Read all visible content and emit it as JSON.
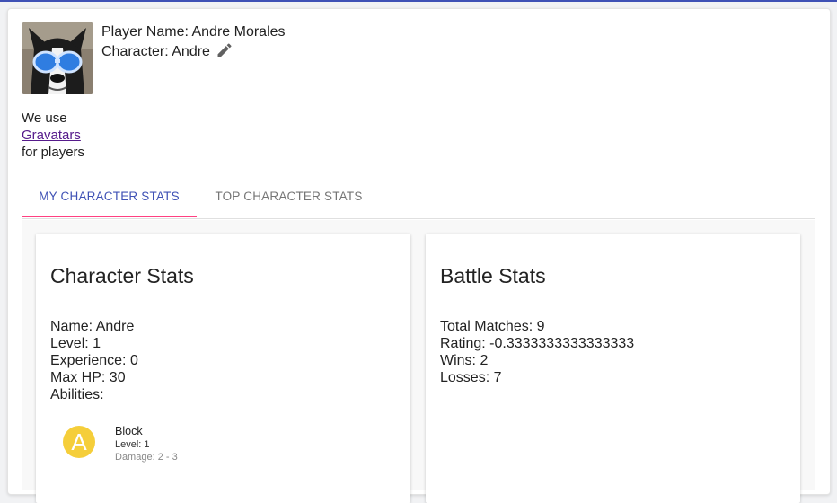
{
  "player": {
    "name_line": "Player Name: Andre Morales",
    "character_line": "Character: Andre",
    "avatar_icon": "dog-with-goggles-gravatar",
    "edit_icon": "pencil-icon"
  },
  "gravatar_note": {
    "prefix": "We use",
    "link": "Gravatars",
    "suffix": "for players"
  },
  "tabs": [
    {
      "label": "MY CHARACTER STATS",
      "active": true
    },
    {
      "label": "TOP CHARACTER STATS",
      "active": false
    }
  ],
  "character_stats": {
    "title": "Character Stats",
    "lines": [
      "Name: Andre",
      "Level: 1",
      "Experience: 0",
      "Max HP: 30",
      "Abilities:"
    ],
    "abilities": [
      {
        "letter": "A",
        "name": "Block",
        "level": "Level: 1",
        "damage": "Damage: 2 - 3"
      }
    ]
  },
  "battle_stats": {
    "title": "Battle Stats",
    "lines": [
      "Total Matches: 9",
      "Rating: -0.3333333333333333",
      "Wins: 2",
      "Losses: 7"
    ]
  },
  "colors": {
    "primary": "#3f51b5",
    "accent": "#ff4081",
    "ability_badge": "#f5ce3a",
    "link_visited": "#551a8b"
  }
}
